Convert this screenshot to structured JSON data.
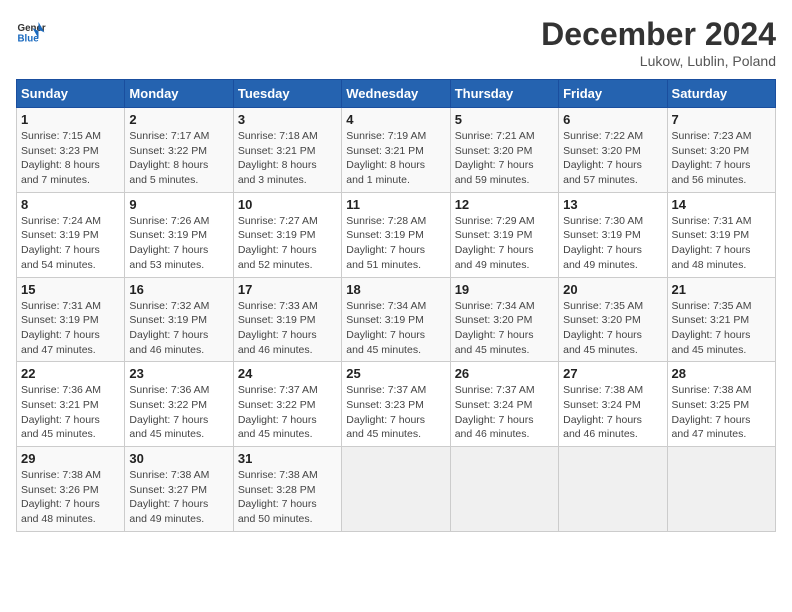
{
  "header": {
    "logo_line1": "General",
    "logo_line2": "Blue",
    "month": "December 2024",
    "location": "Lukow, Lublin, Poland"
  },
  "weekdays": [
    "Sunday",
    "Monday",
    "Tuesday",
    "Wednesday",
    "Thursday",
    "Friday",
    "Saturday"
  ],
  "weeks": [
    [
      {
        "day": "1",
        "detail": "Sunrise: 7:15 AM\nSunset: 3:23 PM\nDaylight: 8 hours\nand 7 minutes."
      },
      {
        "day": "2",
        "detail": "Sunrise: 7:17 AM\nSunset: 3:22 PM\nDaylight: 8 hours\nand 5 minutes."
      },
      {
        "day": "3",
        "detail": "Sunrise: 7:18 AM\nSunset: 3:21 PM\nDaylight: 8 hours\nand 3 minutes."
      },
      {
        "day": "4",
        "detail": "Sunrise: 7:19 AM\nSunset: 3:21 PM\nDaylight: 8 hours\nand 1 minute."
      },
      {
        "day": "5",
        "detail": "Sunrise: 7:21 AM\nSunset: 3:20 PM\nDaylight: 7 hours\nand 59 minutes."
      },
      {
        "day": "6",
        "detail": "Sunrise: 7:22 AM\nSunset: 3:20 PM\nDaylight: 7 hours\nand 57 minutes."
      },
      {
        "day": "7",
        "detail": "Sunrise: 7:23 AM\nSunset: 3:20 PM\nDaylight: 7 hours\nand 56 minutes."
      }
    ],
    [
      {
        "day": "8",
        "detail": "Sunrise: 7:24 AM\nSunset: 3:19 PM\nDaylight: 7 hours\nand 54 minutes."
      },
      {
        "day": "9",
        "detail": "Sunrise: 7:26 AM\nSunset: 3:19 PM\nDaylight: 7 hours\nand 53 minutes."
      },
      {
        "day": "10",
        "detail": "Sunrise: 7:27 AM\nSunset: 3:19 PM\nDaylight: 7 hours\nand 52 minutes."
      },
      {
        "day": "11",
        "detail": "Sunrise: 7:28 AM\nSunset: 3:19 PM\nDaylight: 7 hours\nand 51 minutes."
      },
      {
        "day": "12",
        "detail": "Sunrise: 7:29 AM\nSunset: 3:19 PM\nDaylight: 7 hours\nand 49 minutes."
      },
      {
        "day": "13",
        "detail": "Sunrise: 7:30 AM\nSunset: 3:19 PM\nDaylight: 7 hours\nand 49 minutes."
      },
      {
        "day": "14",
        "detail": "Sunrise: 7:31 AM\nSunset: 3:19 PM\nDaylight: 7 hours\nand 48 minutes."
      }
    ],
    [
      {
        "day": "15",
        "detail": "Sunrise: 7:31 AM\nSunset: 3:19 PM\nDaylight: 7 hours\nand 47 minutes."
      },
      {
        "day": "16",
        "detail": "Sunrise: 7:32 AM\nSunset: 3:19 PM\nDaylight: 7 hours\nand 46 minutes."
      },
      {
        "day": "17",
        "detail": "Sunrise: 7:33 AM\nSunset: 3:19 PM\nDaylight: 7 hours\nand 46 minutes."
      },
      {
        "day": "18",
        "detail": "Sunrise: 7:34 AM\nSunset: 3:19 PM\nDaylight: 7 hours\nand 45 minutes."
      },
      {
        "day": "19",
        "detail": "Sunrise: 7:34 AM\nSunset: 3:20 PM\nDaylight: 7 hours\nand 45 minutes."
      },
      {
        "day": "20",
        "detail": "Sunrise: 7:35 AM\nSunset: 3:20 PM\nDaylight: 7 hours\nand 45 minutes."
      },
      {
        "day": "21",
        "detail": "Sunrise: 7:35 AM\nSunset: 3:21 PM\nDaylight: 7 hours\nand 45 minutes."
      }
    ],
    [
      {
        "day": "22",
        "detail": "Sunrise: 7:36 AM\nSunset: 3:21 PM\nDaylight: 7 hours\nand 45 minutes."
      },
      {
        "day": "23",
        "detail": "Sunrise: 7:36 AM\nSunset: 3:22 PM\nDaylight: 7 hours\nand 45 minutes."
      },
      {
        "day": "24",
        "detail": "Sunrise: 7:37 AM\nSunset: 3:22 PM\nDaylight: 7 hours\nand 45 minutes."
      },
      {
        "day": "25",
        "detail": "Sunrise: 7:37 AM\nSunset: 3:23 PM\nDaylight: 7 hours\nand 45 minutes."
      },
      {
        "day": "26",
        "detail": "Sunrise: 7:37 AM\nSunset: 3:24 PM\nDaylight: 7 hours\nand 46 minutes."
      },
      {
        "day": "27",
        "detail": "Sunrise: 7:38 AM\nSunset: 3:24 PM\nDaylight: 7 hours\nand 46 minutes."
      },
      {
        "day": "28",
        "detail": "Sunrise: 7:38 AM\nSunset: 3:25 PM\nDaylight: 7 hours\nand 47 minutes."
      }
    ],
    [
      {
        "day": "29",
        "detail": "Sunrise: 7:38 AM\nSunset: 3:26 PM\nDaylight: 7 hours\nand 48 minutes."
      },
      {
        "day": "30",
        "detail": "Sunrise: 7:38 AM\nSunset: 3:27 PM\nDaylight: 7 hours\nand 49 minutes."
      },
      {
        "day": "31",
        "detail": "Sunrise: 7:38 AM\nSunset: 3:28 PM\nDaylight: 7 hours\nand 50 minutes."
      },
      {
        "day": "",
        "detail": ""
      },
      {
        "day": "",
        "detail": ""
      },
      {
        "day": "",
        "detail": ""
      },
      {
        "day": "",
        "detail": ""
      }
    ]
  ]
}
